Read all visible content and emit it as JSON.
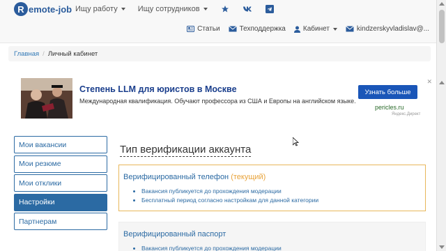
{
  "navbar": {
    "logo_letter": "R",
    "logo_text": "emote-job",
    "find_job": "Ищу работу",
    "find_staff": "Ищу сотрудников",
    "articles": "Статьи",
    "support": "Техподдержка",
    "cabinet": "Кабинет",
    "user": "kindzerskyvladislav@..."
  },
  "breadcrumb": {
    "home": "Главная",
    "current": "Личный кабинет"
  },
  "ad": {
    "title": "Степень LLM для юристов в Москве",
    "description": "Международная квалификация. Обучают профессора из США и Европы на английском языке.",
    "button": "Узнать больше",
    "site": "pericles.ru",
    "source": "Яндекс.Директ"
  },
  "sidebar": {
    "items": [
      {
        "label": "Мои вакансии"
      },
      {
        "label": "Мои резюме"
      },
      {
        "label": "Мои отклики"
      },
      {
        "label": "Настройки"
      },
      {
        "label": "Партнерам"
      }
    ]
  },
  "main": {
    "title": "Тип верификации аккаунта",
    "cards": [
      {
        "title": "Верифицированный телефон",
        "tag": "(текущий)",
        "bullets": [
          "Вакансия публикуется до прохождения модерации",
          "Бесплатный период согласно настройкам для данной категории"
        ]
      },
      {
        "title": "Верифицированный паспорт",
        "bullets": [
          "Вакансия публикуется до прохождения модерации"
        ]
      }
    ]
  },
  "colors": {
    "brand": "#2b6aa3",
    "current_tag": "#e8a33a",
    "ad_button": "#1a56b8"
  }
}
